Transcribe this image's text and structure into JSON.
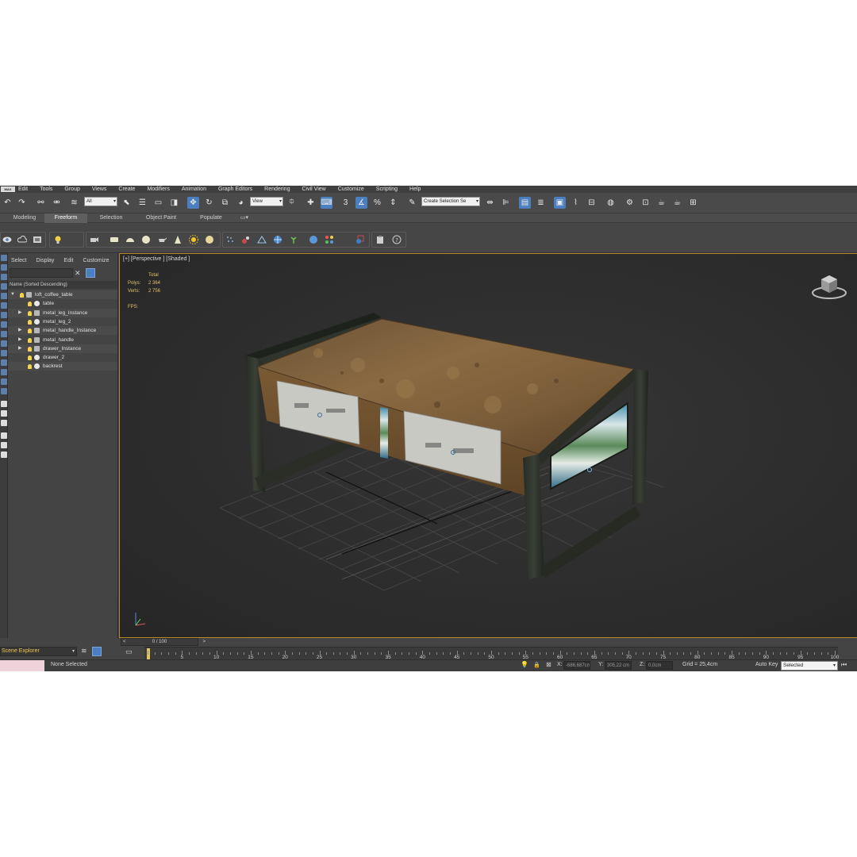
{
  "menubar": {
    "logo": "MAX",
    "items": [
      "Edit",
      "Tools",
      "Group",
      "Views",
      "Create",
      "Modifiers",
      "Animation",
      "Graph Editors",
      "Rendering",
      "Civil View",
      "Customize",
      "Scripting",
      "Help"
    ]
  },
  "toolbar": {
    "filter_value": "All",
    "refcoord_value": "View",
    "snap_label": "3",
    "named_selection_placeholder": "Create Selection Se"
  },
  "ribbon": {
    "tabs": [
      "Modeling",
      "Freeform",
      "Selection",
      "Object Paint",
      "Populate"
    ],
    "active": "Freeform"
  },
  "explorer": {
    "menu": [
      "Select",
      "Display",
      "Edit",
      "Customize"
    ],
    "header": "Name (Sorted Descending)",
    "rows": [
      {
        "label": "loft_coffee_table",
        "depth": 0,
        "expander": "▼",
        "icon": "group"
      },
      {
        "label": "table",
        "depth": 1,
        "expander": "",
        "icon": "object"
      },
      {
        "label": "metal_leg_Instance",
        "depth": 1,
        "expander": "▶",
        "icon": "group"
      },
      {
        "label": "metal_leg_2",
        "depth": 1,
        "expander": "",
        "icon": "object"
      },
      {
        "label": "metal_handle_Instance",
        "depth": 1,
        "expander": "▶",
        "icon": "group"
      },
      {
        "label": "metal_handle",
        "depth": 1,
        "expander": "▶",
        "icon": "group"
      },
      {
        "label": "drawer_Instance",
        "depth": 1,
        "expander": "▶",
        "icon": "group"
      },
      {
        "label": "drawer_2",
        "depth": 1,
        "expander": "",
        "icon": "object"
      },
      {
        "label": "backrest",
        "depth": 1,
        "expander": "",
        "icon": "object"
      }
    ]
  },
  "viewport": {
    "label": "[+] [Perspective ] [Shaded ]",
    "stats": {
      "total_label": "Total",
      "polys_label": "Polys:",
      "polys_value": "2 364",
      "verts_label": "Verts:",
      "verts_value": "2 756",
      "fps_label": "FPS:"
    }
  },
  "timeline": {
    "frame_display": "0 / 100",
    "prev": "<",
    "next": ">",
    "ticks": [
      5,
      10,
      15,
      20,
      25,
      30,
      35,
      40,
      45,
      50,
      55,
      60,
      65,
      70,
      75,
      80,
      85,
      90,
      95,
      100
    ]
  },
  "statusbar": {
    "scene_explorer": "Scene Explorer",
    "status": "None Selected",
    "x_label": "X:",
    "x_value": "-686,687cm",
    "y_label": "Y:",
    "y_value": "305,22 cm",
    "z_label": "Z:",
    "z_value": "0,0cm",
    "grid": "Grid = 25,4cm",
    "autokey_label": "Auto Key",
    "selected_value": "Selected"
  },
  "colors": {
    "accent": "#4c7fbf",
    "viewport_border": "#b58a2a",
    "stats_text": "#e3c26a"
  }
}
